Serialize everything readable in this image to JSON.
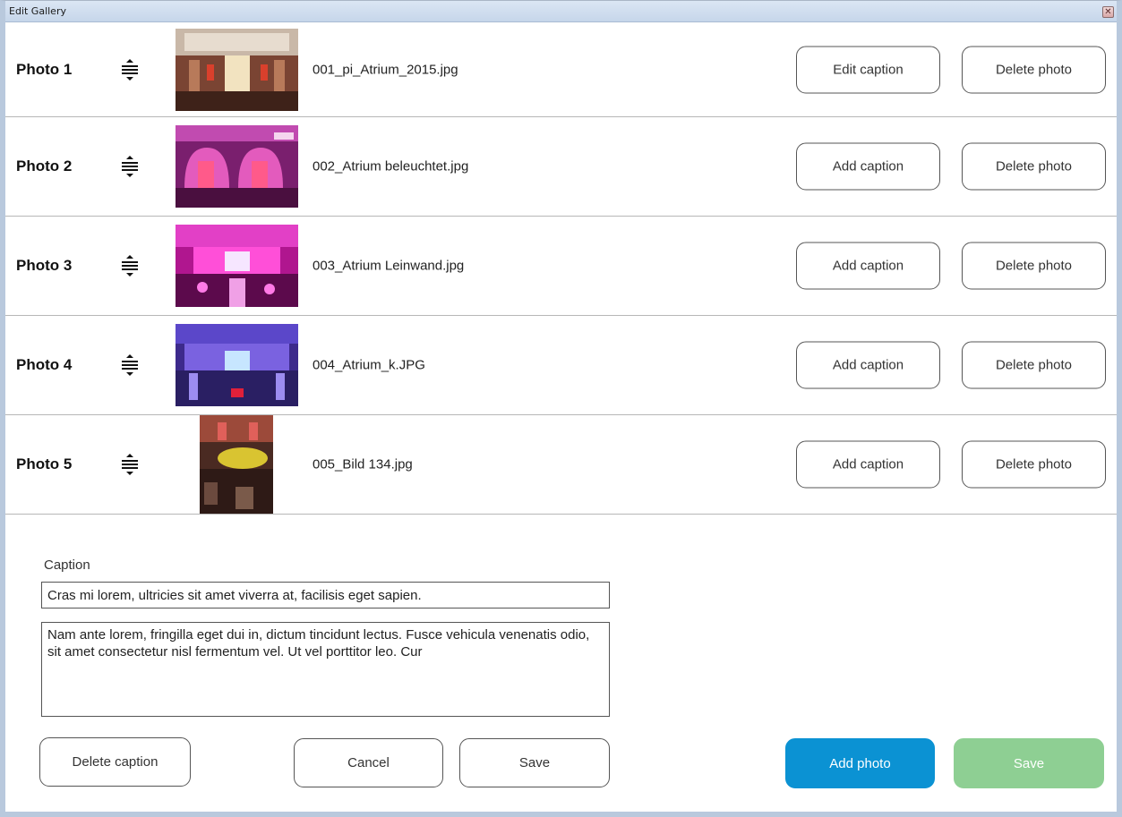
{
  "window": {
    "title": "Edit Gallery",
    "close_icon": "close-icon"
  },
  "photos": [
    {
      "label": "Photo 1",
      "filename": "001_pi_Atrium_2015.jpg",
      "caption_button": "Edit caption",
      "delete_button": "Delete photo"
    },
    {
      "label": "Photo 2",
      "filename": "002_Atrium beleuchtet.jpg",
      "caption_button": "Add caption",
      "delete_button": "Delete photo"
    },
    {
      "label": "Photo 3",
      "filename": "003_Atrium Leinwand.jpg",
      "caption_button": "Add caption",
      "delete_button": "Delete photo"
    },
    {
      "label": "Photo 4",
      "filename": "004_Atrium_k.JPG",
      "caption_button": "Add caption",
      "delete_button": "Delete photo"
    },
    {
      "label": "Photo 5",
      "filename": "005_Bild 134.jpg",
      "caption_button": "Add caption",
      "delete_button": "Delete photo"
    }
  ],
  "caption_editor": {
    "label": "Caption",
    "title_value": "Cras mi lorem, ultricies sit amet viverra at, facilisis eget sapien.",
    "body_value": "Nam ante lorem, fringilla eget dui in, dictum tincidunt lectus. Fusce vehicula venenatis odio, sit amet consectetur nisl fermentum vel. Ut vel porttitor leo. Cur",
    "delete_caption": "Delete caption",
    "cancel": "Cancel",
    "save": "Save"
  },
  "gallery_actions": {
    "add_photo": "Add photo",
    "save": "Save"
  },
  "colors": {
    "add_photo_bg": "#0b92d3",
    "save_disabled_bg": "#8ecf93"
  }
}
